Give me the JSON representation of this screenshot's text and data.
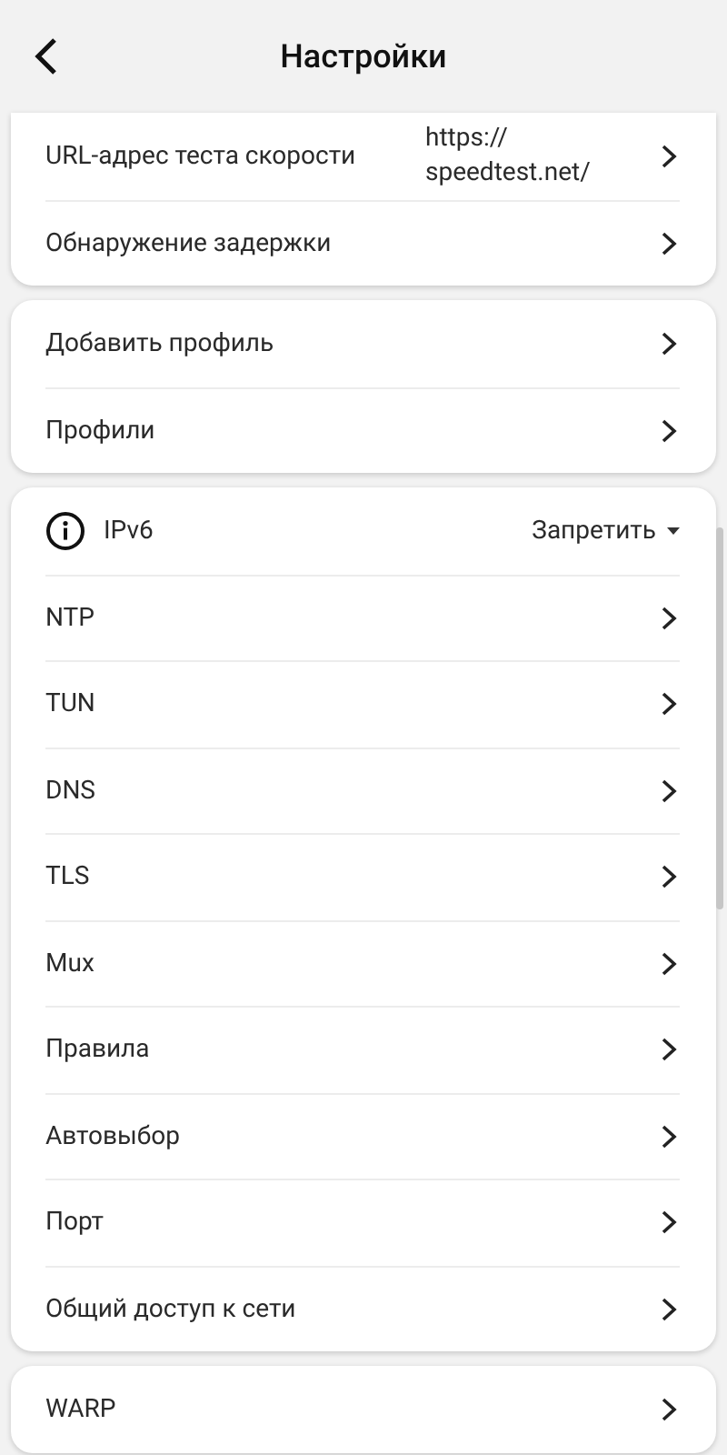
{
  "header": {
    "title": "Настройки"
  },
  "sections": [
    {
      "items": [
        {
          "kind": "link",
          "label": "URL-адрес теста скорости",
          "value": "https:// speedtest.net/"
        },
        {
          "kind": "link",
          "label": "Обнаружение задержки"
        }
      ]
    },
    {
      "items": [
        {
          "kind": "link",
          "label": "Добавить профиль"
        },
        {
          "kind": "link",
          "label": "Профили"
        }
      ]
    },
    {
      "items": [
        {
          "kind": "dropdown",
          "label": "IPv6",
          "value": "Запретить"
        },
        {
          "kind": "link",
          "label": "NTP"
        },
        {
          "kind": "link",
          "label": "TUN"
        },
        {
          "kind": "link",
          "label": "DNS"
        },
        {
          "kind": "link",
          "label": "TLS"
        },
        {
          "kind": "link",
          "label": "Mux"
        },
        {
          "kind": "link",
          "label": "Правила"
        },
        {
          "kind": "link",
          "label": "Автовыбор"
        },
        {
          "kind": "link",
          "label": "Порт"
        },
        {
          "kind": "link",
          "label": "Общий доступ к сети"
        }
      ]
    },
    {
      "items": [
        {
          "kind": "link",
          "label": "WARP"
        }
      ]
    }
  ]
}
